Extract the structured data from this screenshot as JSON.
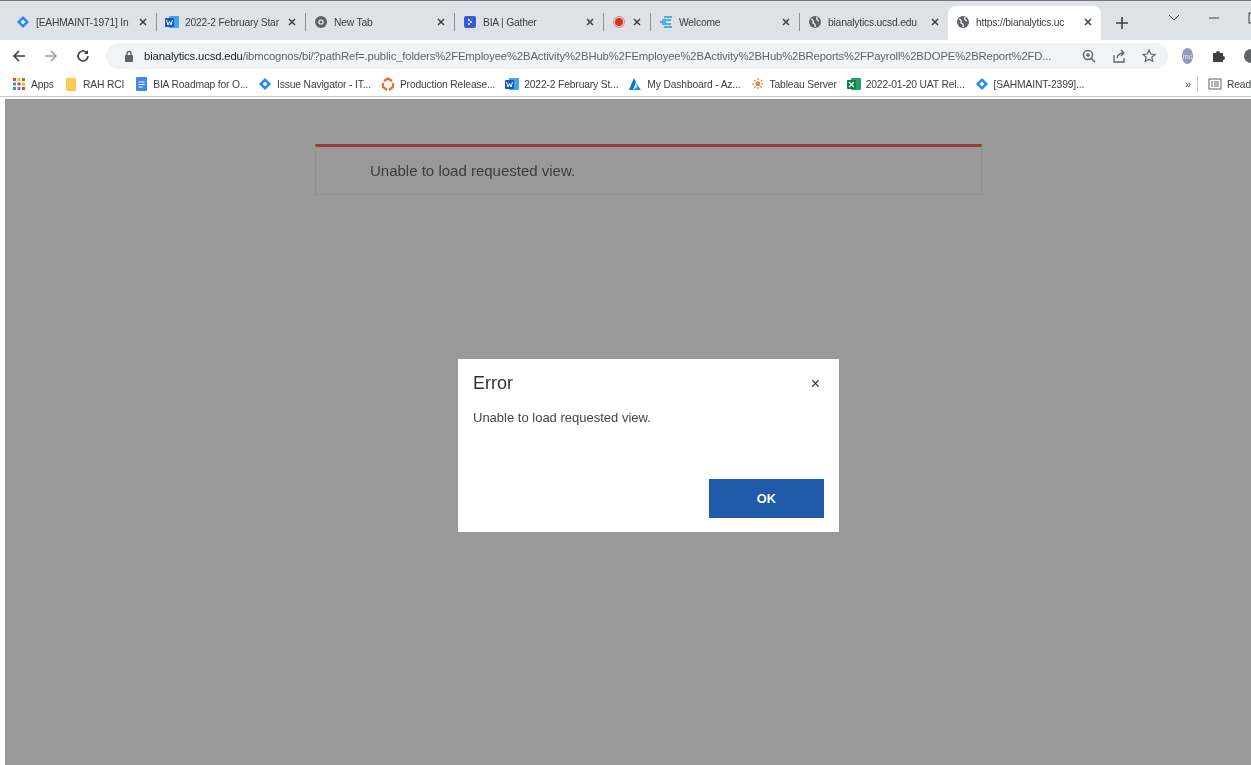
{
  "tabs": [
    {
      "kind": "diamond",
      "title": "[EAHMAINT-1971] In",
      "selected": false
    },
    {
      "kind": "word",
      "title": "2022-2 February Star",
      "selected": false
    },
    {
      "kind": "chrome",
      "title": "New Tab",
      "selected": false
    },
    {
      "kind": "gather",
      "title": "BIA | Gather",
      "selected": false
    },
    {
      "kind": "record",
      "selected": false
    },
    {
      "kind": "welcome",
      "title": "Welcome",
      "selected": false
    },
    {
      "kind": "globe",
      "title": "bianalytics.ucsd.edu",
      "selected": false
    },
    {
      "kind": "globe",
      "title": "https://bianalytics.uc",
      "selected": true
    }
  ],
  "address": {
    "host": "bianalytics.ucsd.edu",
    "path": "/ibmcognos/bi/?pathRef=.public_folders%2FEmployee%2BActivity%2BHub%2FEmployee%2BActivity%2BHub%2BReports%2FPayroll%2BDOPE%2BReport%2FD..."
  },
  "profile": {
    "initials": "mc"
  },
  "bookmarks": [
    {
      "kind": "apps",
      "label": "Apps"
    },
    {
      "kind": "folder",
      "label": "RAH RCI"
    },
    {
      "kind": "doc",
      "label": "BIA Roadmap for O..."
    },
    {
      "kind": "diamond",
      "label": "Issue Navigator - IT..."
    },
    {
      "kind": "release",
      "label": "Production Release..."
    },
    {
      "kind": "word",
      "label": "2022-2 February St..."
    },
    {
      "kind": "azure",
      "label": "My Dashboard - Az..."
    },
    {
      "kind": "tableau",
      "label": "Tableau Server"
    },
    {
      "kind": "excel",
      "label": "2022-01-20 UAT Rel..."
    },
    {
      "kind": "diamond",
      "label": "[SAHMAINT-2399]..."
    }
  ],
  "bookmarks_overflow": "»",
  "reading_list": "Read",
  "banner": {
    "message": "Unable to load requested view."
  },
  "dialog": {
    "title": "Error",
    "close": "×",
    "message": "Unable to load requested view.",
    "button": "OK"
  }
}
